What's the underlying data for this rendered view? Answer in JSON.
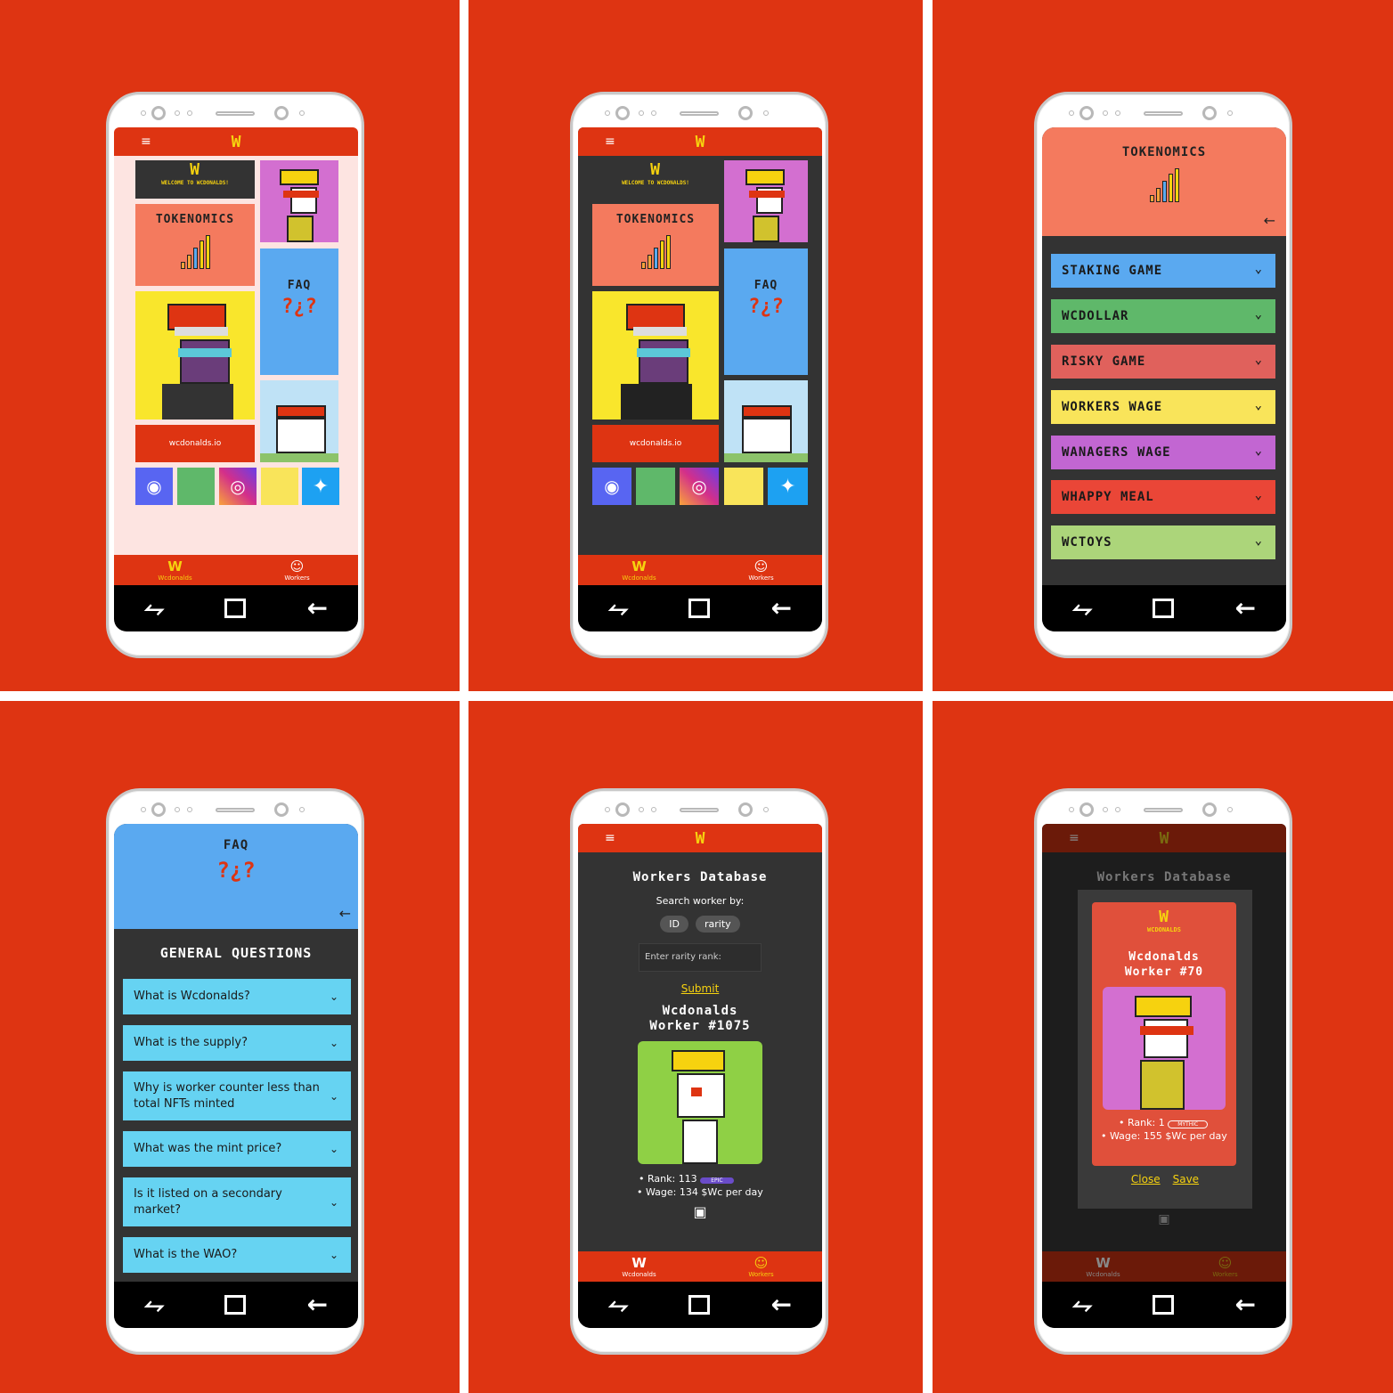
{
  "app": {
    "logo": "W",
    "menu_icon": "≡"
  },
  "home": {
    "welcome": "WELCOME TO WCDONALDS!",
    "tokenomics": "TOKENOMICS",
    "faq": "FAQ",
    "faq_icon": "?¿?",
    "site": "wcdonalds.io",
    "tabs": [
      {
        "label": "Wcdonalds"
      },
      {
        "label": "Workers"
      }
    ]
  },
  "tokenomics": {
    "title": "TOKENOMICS",
    "back": "←",
    "items": [
      {
        "label": "STAKING GAME",
        "color": "#5aa9f0"
      },
      {
        "label": "WCDOLLAR",
        "color": "#5fb86a"
      },
      {
        "label": "RISKY GAME",
        "color": "#e0615c"
      },
      {
        "label": "WORKERS WAGE",
        "color": "#f9e45a"
      },
      {
        "label": "WANAGERS WAGE",
        "color": "#c266d2"
      },
      {
        "label": "WHAPPY MEAL",
        "color": "#ea4637"
      },
      {
        "label": "WCTOYS",
        "color": "#acd57a"
      }
    ]
  },
  "faq": {
    "title": "FAQ",
    "icon": "?¿?",
    "back": "←",
    "section": "GENERAL QUESTIONS",
    "questions": [
      "What is Wcdonalds?",
      "What is the supply?",
      "Why is worker counter less than total NFTs minted",
      "What was the mint price?",
      "Is it listed on a secondary market?",
      "What is the WAO?"
    ]
  },
  "workers": {
    "title": "Workers Database",
    "search_label": "Search worker by:",
    "option_id": "ID",
    "option_rarity": "rarity",
    "input_placeholder": "Enter rarity rank:",
    "submit": "Submit",
    "worker_name_1": "Wcdonalds",
    "worker_name_2": "Worker #1075",
    "rank_label": "• Rank:",
    "rank_value": "113",
    "rank_badge": "EPIC",
    "wage_label": "• Wage:",
    "wage_value": "134 $Wc per day"
  },
  "modal": {
    "logo_sub": "WCDONALDS",
    "worker_name_1": "Wcdonalds",
    "worker_name_2": "Worker #70",
    "rank_label": "• Rank:",
    "rank_value": "1",
    "rank_badge": "MYTHIC",
    "wage_label": "• Wage:",
    "wage_value": "155 $Wc per day",
    "close": "Close",
    "save": "Save"
  },
  "nav": {
    "recent": "⥊",
    "home": "□",
    "back": "←"
  }
}
